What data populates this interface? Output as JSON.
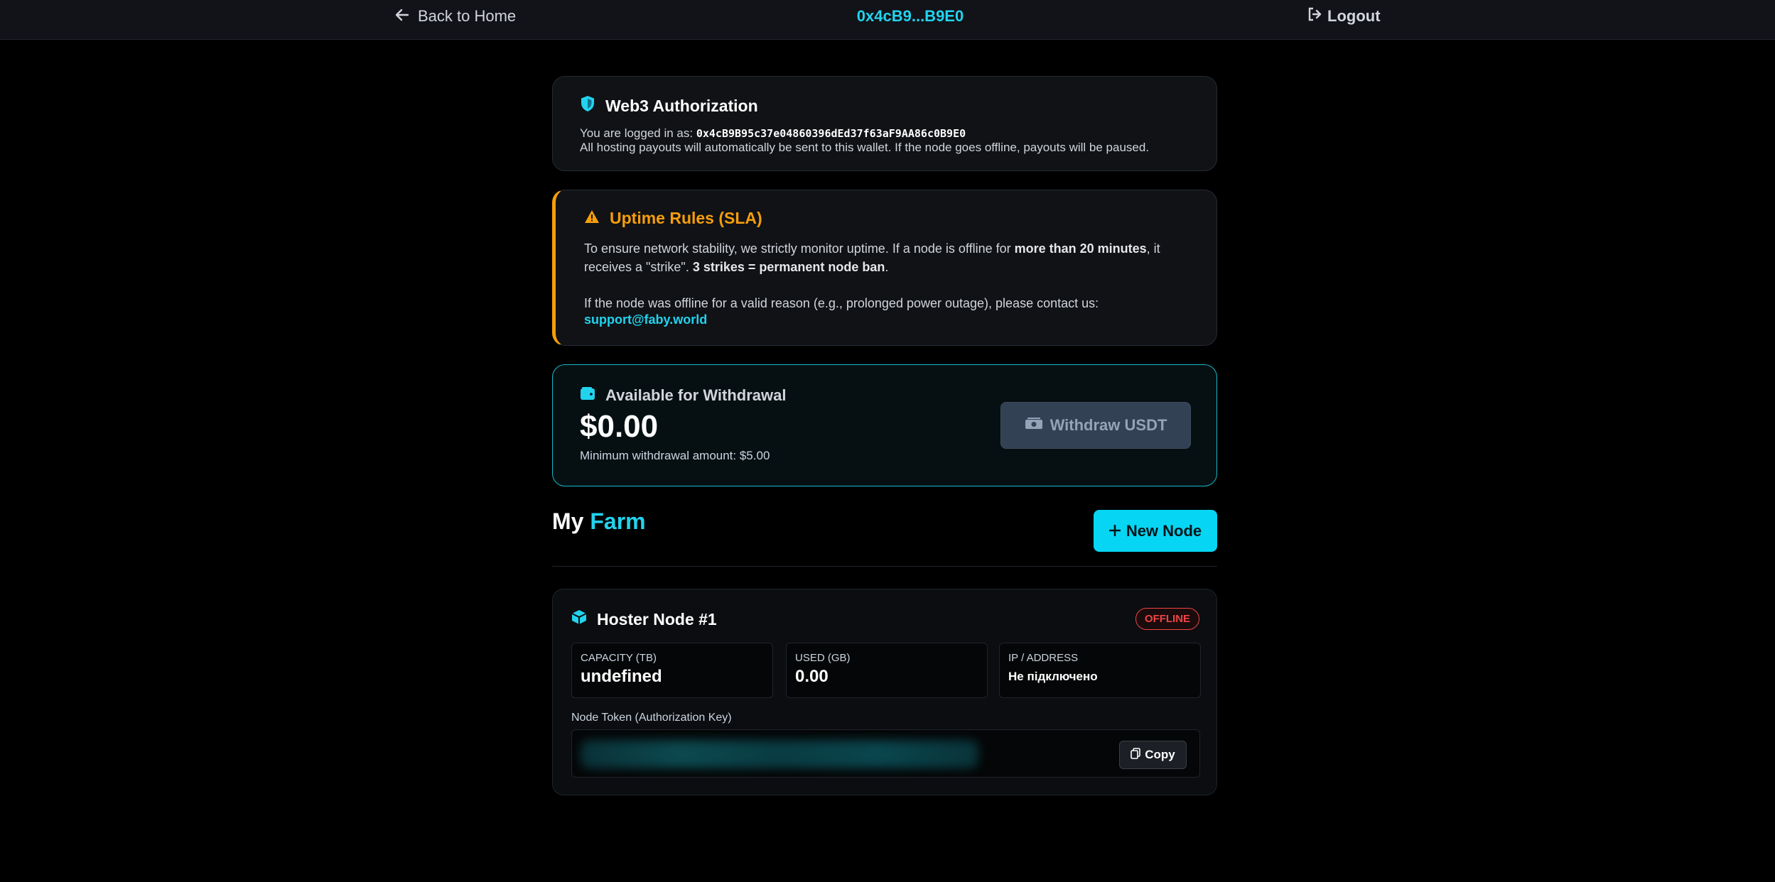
{
  "topbar": {
    "back_label": "Back to Home",
    "wallet_short": "0x4cB9...B9E0",
    "logout_label": "Logout"
  },
  "auth": {
    "title": "Web3 Authorization",
    "logged_prefix": "You are logged in as:",
    "address": "0x4cB9B95c37e04860396dEd37f63aF9AA86c0B9E0",
    "note": "All hosting payouts will automatically be sent to this wallet. If the node goes offline, payouts will be paused."
  },
  "sla": {
    "title": "Uptime Rules (SLA)",
    "p1_a": "To ensure network stability, we strictly monitor uptime. If a node is offline for ",
    "p1_b": "more than 20 minutes",
    "p1_c": ", it receives a \"strike\". ",
    "p1_d": "3 strikes = permanent node ban",
    "p1_e": ".",
    "p2": "If the node was offline for a valid reason (e.g., prolonged power outage), please contact us:",
    "email": "support@faby.world"
  },
  "withdraw": {
    "title": "Available for Withdrawal",
    "amount": "$0.00",
    "min_note": "Minimum withdrawal amount: $5.00",
    "button_label": "Withdraw USDT"
  },
  "farm": {
    "title_a": "My ",
    "title_b": "Farm",
    "new_node_label": "New Node"
  },
  "node": {
    "name": "Hoster Node #1",
    "status": "OFFLINE",
    "capacity_label": "CAPACITY (TB)",
    "capacity_value": "undefined",
    "used_label": "USED (GB)",
    "used_value": "0.00",
    "ip_label": "IP / ADDRESS",
    "ip_value": "Не підключено",
    "token_label": "Node Token (Authorization Key)",
    "copy_label": "Copy"
  },
  "colors": {
    "accent": "#22d3ee",
    "warning": "#f59e0b",
    "danger": "#ef4444"
  }
}
